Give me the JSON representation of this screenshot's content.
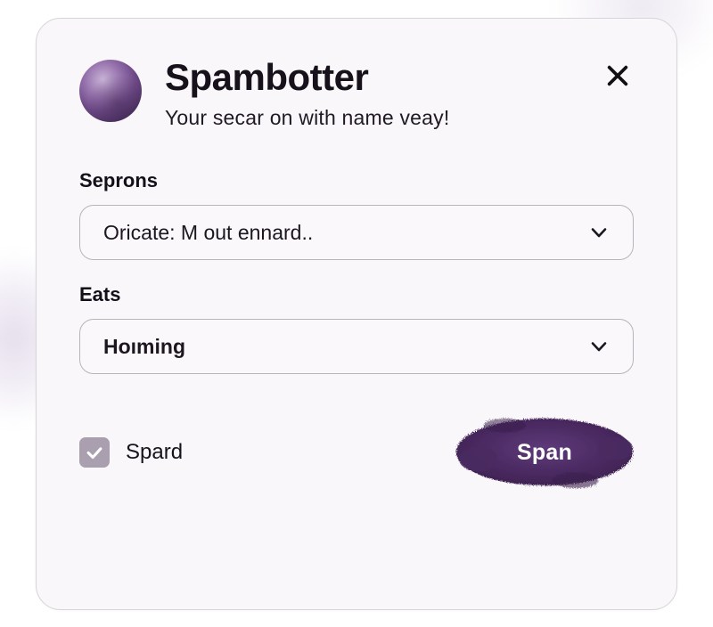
{
  "header": {
    "title": "Spambotter",
    "subtitle": "Your secar on with name veay!"
  },
  "fields": {
    "seprons": {
      "label": "Seprons",
      "value": "Oricate: M out ennard.."
    },
    "eats": {
      "label": "Eats",
      "value": "Hoıming"
    }
  },
  "footer": {
    "checkbox_label": "Spard",
    "checkbox_checked": true,
    "primary_button": "Span"
  },
  "colors": {
    "accent": "#4c2a63",
    "text": "#16111a",
    "border": "#b9b3bd"
  }
}
